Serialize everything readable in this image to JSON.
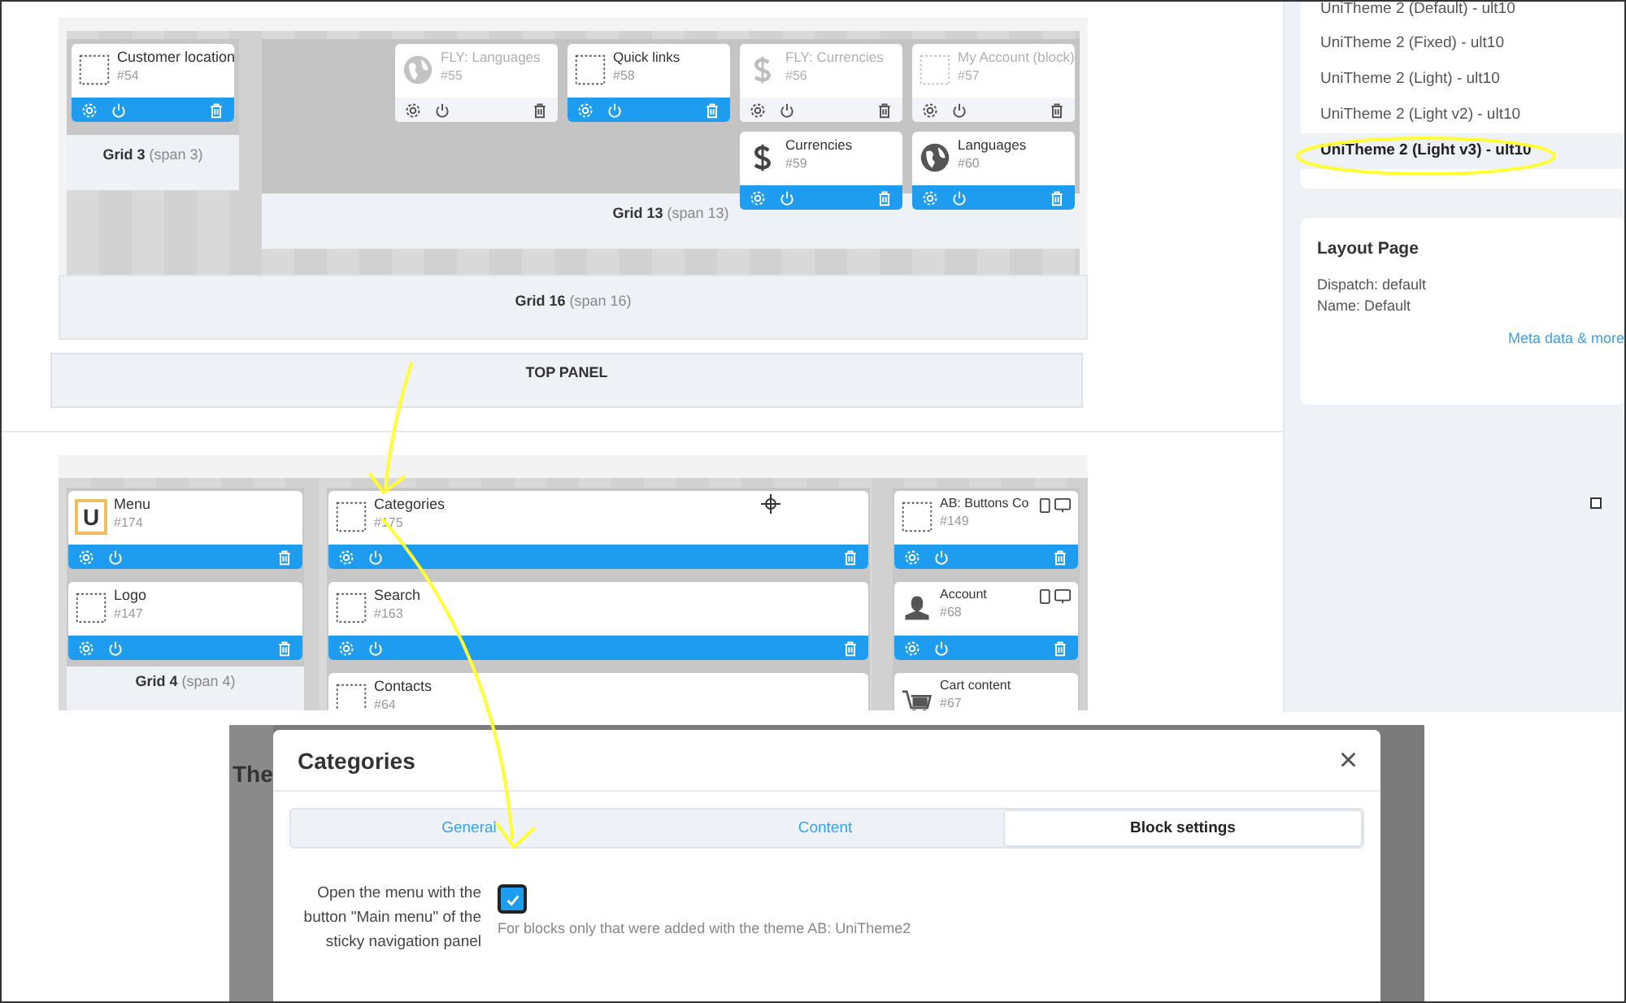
{
  "layout_top": {
    "grids": [
      {
        "name": "Grid 3",
        "span": "(span 3)",
        "rows": [
          [
            {
              "title": "Customer location",
              "id": "#54",
              "kind": "placeholder",
              "active": true
            }
          ]
        ]
      },
      {
        "name": "Grid 13",
        "span": "(span 13)",
        "rows": [
          [
            {
              "title": "FLY: Languages",
              "id": "#55",
              "kind": "globe",
              "active": false
            },
            {
              "title": "Quick links",
              "id": "#58",
              "kind": "placeholder",
              "active": true
            },
            {
              "title": "FLY: Currencies",
              "id": "#56",
              "kind": "dollar",
              "active": false
            },
            {
              "title": "My Account (block)",
              "id": "#57",
              "kind": "placeholder",
              "active": false
            }
          ],
          [
            "",
            "",
            {
              "title": "Currencies",
              "id": "#59",
              "kind": "dollar",
              "active": true
            },
            {
              "title": "Languages",
              "id": "#60",
              "kind": "globe",
              "active": true
            }
          ]
        ]
      }
    ],
    "outer_grid": {
      "name": "Grid 16",
      "span": "(span 16)"
    },
    "panel": "TOP PANEL"
  },
  "layout_main": {
    "grids": [
      {
        "name": "Grid 4",
        "span": "(span 4)",
        "rows": [
          [
            {
              "title": "Menu",
              "id": "#174",
              "kind": "letter",
              "icon_text": "U",
              "active": true
            }
          ],
          [
            {
              "title": "Logo",
              "id": "#147",
              "kind": "placeholder",
              "active": true
            }
          ]
        ]
      },
      {
        "rows": [
          [
            {
              "title": "Categories",
              "id": "#175",
              "kind": "placeholder",
              "active": true
            }
          ],
          [
            {
              "title": "Search",
              "id": "#163",
              "kind": "placeholder",
              "active": true
            }
          ],
          [
            {
              "title": "Contacts",
              "id": "#64",
              "kind": "placeholder",
              "active": true
            }
          ]
        ]
      },
      {
        "rows": [
          [
            {
              "title": "AB: Buttons Co",
              "id": "#149",
              "kind": "placeholder",
              "active": true,
              "devices": true
            }
          ],
          [
            {
              "title": "Account",
              "id": "#68",
              "kind": "person",
              "active": true,
              "devices": true
            }
          ],
          [
            {
              "title": "Cart content",
              "id": "#67",
              "kind": "cart",
              "active": true
            }
          ]
        ]
      }
    ]
  },
  "sidebar": {
    "themes": [
      {
        "label": "UniTheme 2 (Default) - ult10",
        "selected": false
      },
      {
        "label": "UniTheme 2 (Fixed) - ult10",
        "selected": false
      },
      {
        "label": "UniTheme 2 (Light) - ult10",
        "selected": false
      },
      {
        "label": "UniTheme 2 (Light v2) - ult10",
        "selected": false
      },
      {
        "label": "UniTheme 2 (Light v3) - ult10",
        "selected": true
      }
    ],
    "layout_page": {
      "title": "Layout Page",
      "lines": [
        "Dispatch: default",
        "Name: Default"
      ],
      "link": "Meta data & more"
    }
  },
  "backdrop": {
    "heading": "The"
  },
  "dialog": {
    "title": "Categories",
    "close": "×",
    "tabs": [
      {
        "label": "General",
        "selected": false
      },
      {
        "label": "Content",
        "selected": false
      },
      {
        "label": "Block settings",
        "selected": true
      }
    ],
    "setting": {
      "label": "Open the menu with the button \"Main menu\" of the sticky navigation panel",
      "checked": true,
      "hint": "For blocks only that were added with the theme AB: UniTheme2"
    }
  }
}
